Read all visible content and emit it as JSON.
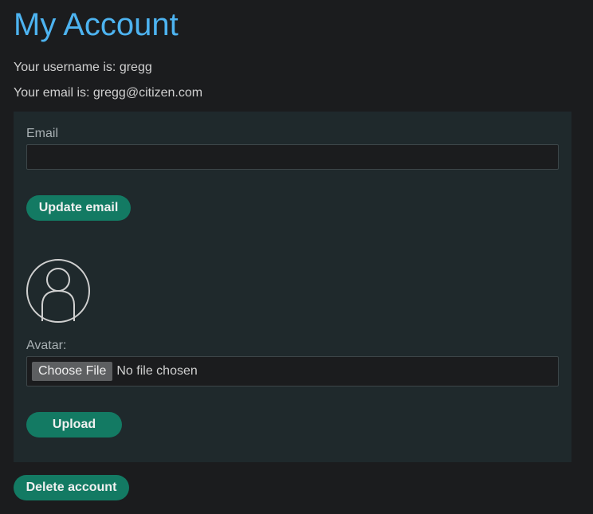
{
  "page": {
    "title": "My Account",
    "username_line": "Your username is: gregg",
    "email_line": "Your email is: gregg@citizen.com"
  },
  "email_form": {
    "label": "Email",
    "value": "",
    "placeholder": "",
    "submit_label": "Update email"
  },
  "avatar_form": {
    "avatar_icon": "user-avatar-icon",
    "label": "Avatar:",
    "choose_label": "Choose File",
    "status": "No file chosen",
    "submit_label": "Upload"
  },
  "actions": {
    "delete_label": "Delete account"
  },
  "colors": {
    "title": "#4db3f0",
    "button": "#137a63",
    "panel": "#1f292c",
    "background": "#1b1c1e"
  }
}
